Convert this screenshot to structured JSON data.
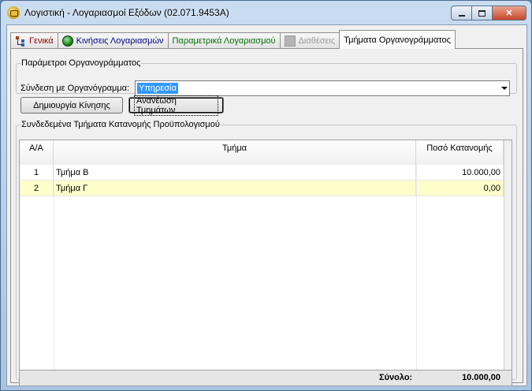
{
  "window": {
    "title": "Λογιστική - Λογαριασμοί Εξόδων (02.071.9453A)",
    "buttons": {
      "minimize": "minimize",
      "maximize": "maximize",
      "close": "✕"
    }
  },
  "tabs": [
    {
      "label": "Γενικά",
      "icon": "org-tree-icon",
      "color": "#8b0000"
    },
    {
      "label": "Κινήσεις Λογαριασμών",
      "icon": "globe-icon",
      "color": "#00008b"
    },
    {
      "label": "Παραμετρικά Λογαριασμού",
      "icon": "",
      "color": "#007000"
    },
    {
      "label": "Διαθέσεις",
      "icon": "disabled-icon",
      "color": "#9a9a9a"
    },
    {
      "label": "Τμήματα Οργανογράμματος",
      "icon": "",
      "color": "#000000",
      "active": true
    }
  ],
  "params": {
    "legend": "Παράμετροι Οργανογράμματος",
    "link_label": "Σύνδεση με Οργανόγραμμα:",
    "link_value": "Υπηρεσία"
  },
  "actions": {
    "create_label": "Δημιουργία Κίνησης",
    "refresh_label": "Ανανέωση Τμημάτων"
  },
  "departments": {
    "legend": "Συνδεδεμένα Τμήματα Κατανομής Προϋπολογισμού",
    "columns": [
      "Α/Α",
      "Τμήμα",
      "Ποσό Κατανομής"
    ],
    "rows": [
      {
        "num": "1",
        "dept": "Τμήμα Β",
        "amount": "10.000,00"
      },
      {
        "num": "2",
        "dept": "Τμήμα Γ",
        "amount": "0,00"
      }
    ],
    "total_label": "Σύνολο:",
    "total_value": "10.000,00"
  }
}
